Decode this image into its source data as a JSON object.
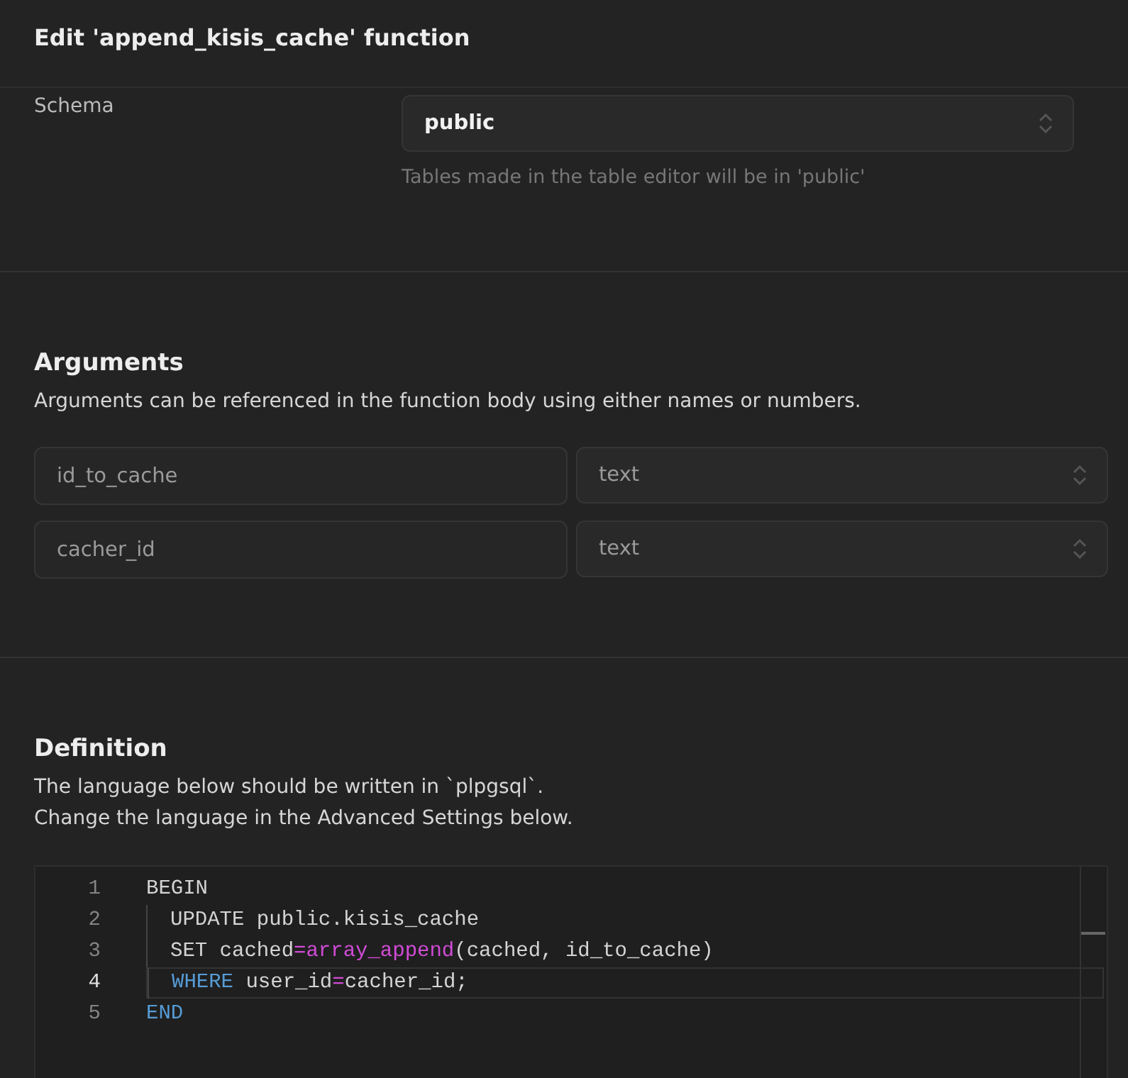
{
  "title": "Edit 'append_kisis_cache' function",
  "schema": {
    "label": "Schema",
    "value": "public",
    "hint": "Tables made in the table editor will be in 'public'"
  },
  "arguments": {
    "heading": "Arguments",
    "description": "Arguments can be referenced in the function body using either names or numbers.",
    "rows": [
      {
        "name": "id_to_cache",
        "type": "text"
      },
      {
        "name": "cacher_id",
        "type": "text"
      }
    ]
  },
  "definition": {
    "heading": "Definition",
    "description_lines": [
      "The language below should be written in `plpgsql`.",
      "Change the language in the Advanced Settings below."
    ],
    "code_lines": [
      {
        "number": "1",
        "indented": false,
        "current": false,
        "tokens": [
          {
            "kind": "plain",
            "text": "BEGIN"
          }
        ]
      },
      {
        "number": "2",
        "indented": true,
        "current": false,
        "tokens": [
          {
            "kind": "plain",
            "text": "UPDATE public.kisis_cache"
          }
        ]
      },
      {
        "number": "3",
        "indented": true,
        "current": false,
        "tokens": [
          {
            "kind": "plain",
            "text": "SET cached"
          },
          {
            "kind": "operator",
            "text": "="
          },
          {
            "kind": "function",
            "text": "array_append"
          },
          {
            "kind": "plain",
            "text": "(cached, id_to_cache)"
          }
        ]
      },
      {
        "number": "4",
        "indented": true,
        "current": true,
        "tokens": [
          {
            "kind": "keyword",
            "text": "WHERE"
          },
          {
            "kind": "plain",
            "text": " user_id"
          },
          {
            "kind": "operator",
            "text": "="
          },
          {
            "kind": "plain",
            "text": "cacher_id;"
          }
        ]
      },
      {
        "number": "5",
        "indented": false,
        "current": false,
        "tokens": [
          {
            "kind": "keyword",
            "text": "END"
          }
        ]
      }
    ]
  }
}
